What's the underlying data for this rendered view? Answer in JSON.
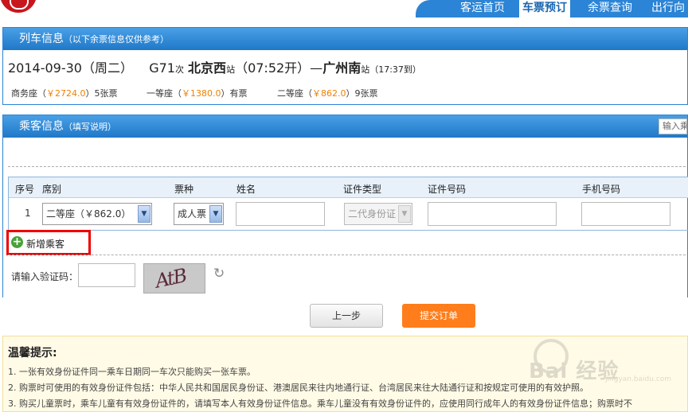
{
  "nav": {
    "items": [
      {
        "label": "客运首页"
      },
      {
        "label": "车票预订"
      },
      {
        "label": "余票查询"
      },
      {
        "label": "出行向"
      }
    ],
    "active_index": 1
  },
  "train_panel": {
    "title": "列车信息",
    "subtitle": "（以下余票信息仅供参考）",
    "date": "2014-09-30（周二）",
    "train_no": "G71",
    "train_suffix": "次",
    "from": "北京西",
    "from_suffix": "站",
    "depart": "（07:52开）—",
    "to": "广州南",
    "to_suffix": "站",
    "arrive": "（17:37到）",
    "seats": [
      {
        "name": "商务座（",
        "price": "￥2724.0",
        "rest": "）5张票"
      },
      {
        "name": "一等座（",
        "price": "￥1380.0",
        "rest": "）有票"
      },
      {
        "name": "二等座（",
        "price": "￥862.0",
        "rest": "）9张票"
      }
    ]
  },
  "passenger_panel": {
    "title": "乘客信息",
    "help": "（填写说明）",
    "search_placeholder": "输入乘",
    "headers": [
      "序号",
      "席别",
      "票种",
      "姓名",
      "证件类型",
      "证件号码",
      "手机号码"
    ],
    "row": {
      "index": "1",
      "seat": "二等座（￥862.0）",
      "ticket_type": "成人票",
      "name": "",
      "id_type": "二代身份证",
      "id_no": "",
      "phone": ""
    },
    "add_passenger": "新增乘客",
    "captcha_label": "请输入验证码：",
    "captcha_text": "AtB"
  },
  "actions": {
    "prev": "上一步",
    "submit": "提交订单"
  },
  "tips": {
    "title": "温馨提示:",
    "lines": [
      "1. 一张有效身份证件同一乘车日期同一车次只能购买一张车票。",
      "2. 购票时可使用的有效身份证件包括：中华人民共和国居民身份证、港澳居民来往内地通行证、台湾居民来往大陆通行证和按规定可使用的有效护照。",
      "3. 购买儿童票时，乘车儿童有有效身份证件的，请填写本人有效身份证件信息。乘车儿童没有有效身份证件的，应使用同行成年人的有效身份证件信息；购票时不"
    ]
  },
  "watermark": {
    "text": "Bai  经验",
    "sub": "jingyan.baidu.com"
  }
}
